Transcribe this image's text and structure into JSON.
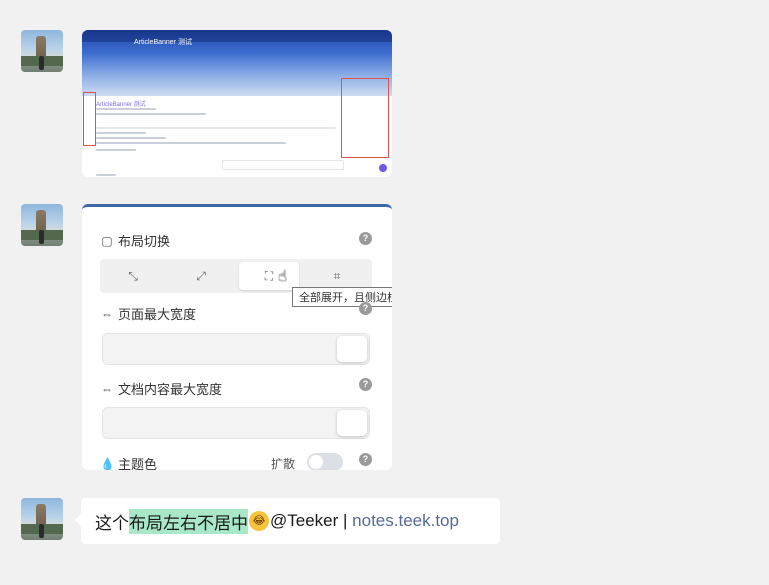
{
  "messages": [
    {
      "type": "image",
      "description_lines": {
        "banner_title": "ArticleBanner 测试",
        "content_title": "ArticleBanner 测试"
      }
    },
    {
      "type": "image",
      "panel": {
        "layout_switch": {
          "title": "布局切换",
          "help": "?",
          "tooltip": "全部展开，且侧边栏"
        },
        "page_max_width": {
          "title": "页面最大宽度",
          "help": "?"
        },
        "doc_max_width": {
          "title": "文档内容最大宽度",
          "help": "?"
        },
        "theme_color": {
          "title": "主题色",
          "help": "?",
          "expand_label": "扩散"
        }
      }
    },
    {
      "type": "text",
      "prefix": "这个",
      "highlight": "布局左右不居中",
      "emoji": "😂",
      "mention": "@Teeker",
      "separator": " | ",
      "link": "notes.teek.top"
    }
  ],
  "icons": {
    "layout": "layout-icon",
    "width": "width-arrows-icon",
    "theme": "droplet-icon"
  },
  "colors": {
    "background": "#f1f1f1",
    "highlight": "#a8e8c8",
    "link": "#576b95",
    "panel_accent": "#3f68a6"
  }
}
